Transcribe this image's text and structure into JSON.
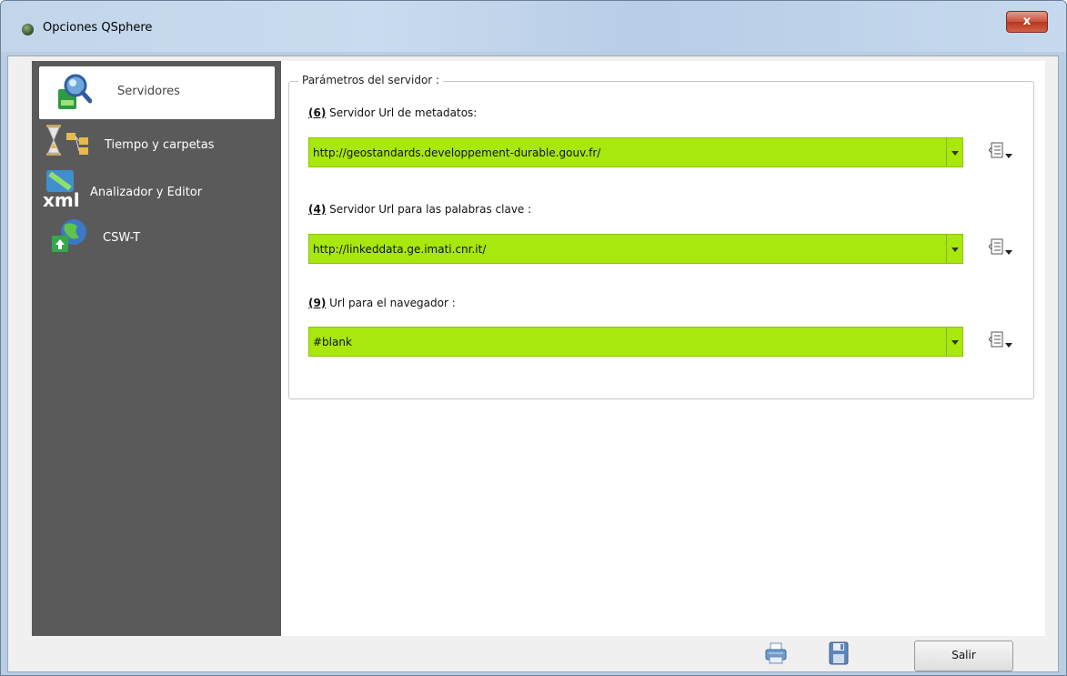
{
  "window": {
    "title": "Opciones QSphere",
    "close_label": "x"
  },
  "sidebar": {
    "items": [
      {
        "label": "Servidores",
        "icon": "server-search-icon",
        "active": true
      },
      {
        "label": "Tiempo y carpetas",
        "icon": "hourglass-folders-icon",
        "active": false
      },
      {
        "label": "Analizador y Editor",
        "icon": "xml-icon",
        "active": false
      },
      {
        "label": "CSW-T",
        "icon": "globe-upload-icon",
        "active": false
      }
    ]
  },
  "group": {
    "title": "Parámetros del servidor :"
  },
  "fields": [
    {
      "number": "(6)",
      "label": " Servidor Url de metadatos:",
      "value": "http://geostandards.developpement-durable.gouv.fr/"
    },
    {
      "number": "(4)",
      "label": " Servidor Url para las palabras clave :",
      "value": "http://linkeddata.ge.imati.cnr.it/"
    },
    {
      "number": "(9)",
      "label": " Url para el navegador :",
      "value": "#blank"
    }
  ],
  "footer": {
    "exit_label": "Salir",
    "print_icon": "print-icon",
    "save_icon": "save-icon"
  },
  "colors": {
    "combo_bg": "#a8e80e",
    "sidebar_bg": "#5a5a5a"
  }
}
